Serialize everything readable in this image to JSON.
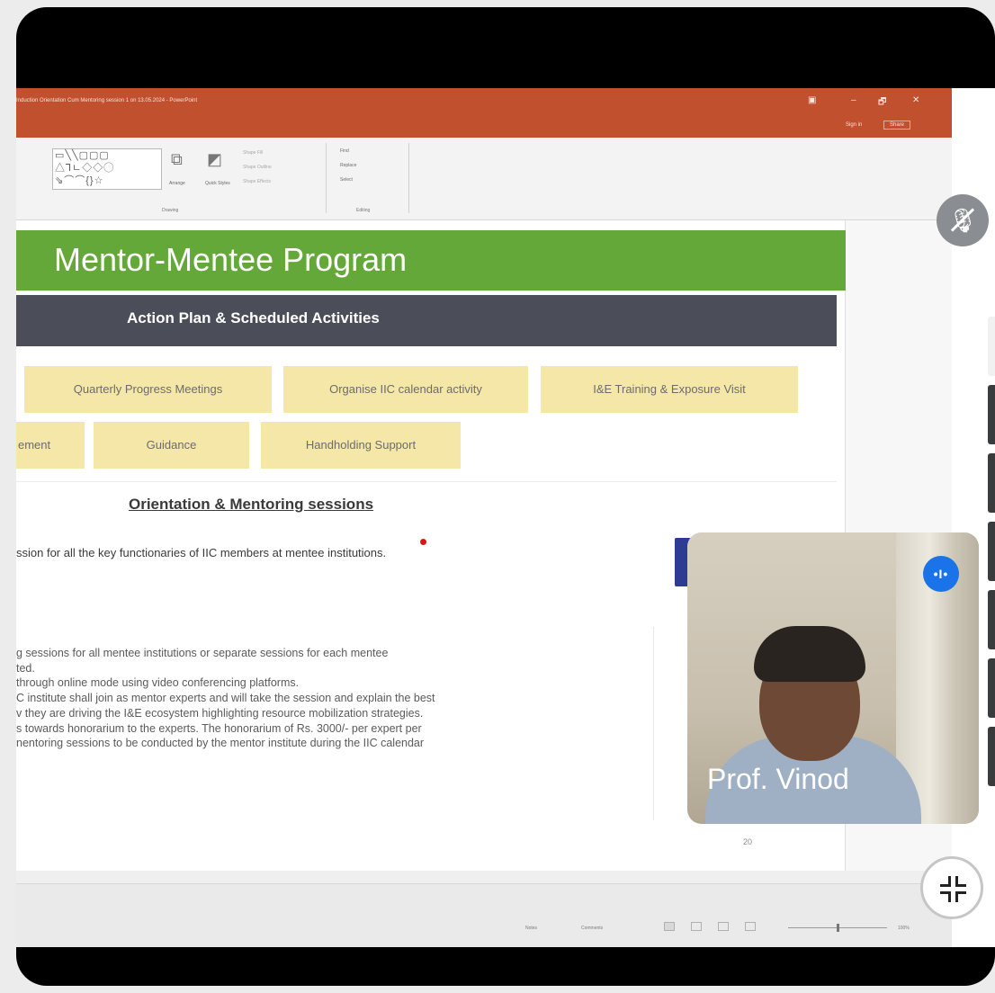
{
  "window": {
    "title": "Induction Orientation Cum Mentoring session 1 on 13.05.2024 - PowerPoint",
    "controls": [
      "▣",
      "–",
      "🗗",
      "✕"
    ],
    "sign_in": "Sign in",
    "share": "Share"
  },
  "ribbon": {
    "arrange_label": "Arrange",
    "quick_styles_label": "Quick Styles",
    "shape_fill": "Shape Fill",
    "shape_outline": "Shape Outline",
    "shape_effects": "Shape Effects",
    "drawing_group": "Drawing",
    "find": "Find",
    "replace": "Replace",
    "select": "Select",
    "editing_group": "Editing"
  },
  "slide": {
    "title": "Mentor-Mentee Program",
    "subtitle": "Action Plan & Scheduled Activities",
    "pills_row1": [
      "Quarterly Progress Meetings",
      "Organise IIC calendar activity",
      "I&E Training & Exposure Visit"
    ],
    "pills_row2": [
      "ement",
      "Guidance",
      "Handholding Support"
    ],
    "section_heading": "Orientation & Mentoring sessions",
    "session_line": "ssion for all the key functionaries of IIC members at mentee institutions.",
    "paragraph": [
      "g sessions for all mentee institutions or separate sessions for each mentee",
      "ted.",
      " through online mode using video conferencing platforms.",
      "C institute shall join as mentor experts and will take the session and explain the best",
      "v they are driving the I&E ecosystem highlighting resource mobilization strategies.",
      "s towards honorarium to the experts. The honorarium of Rs. 3000/- per expert per",
      "nentoring sessions to be conducted by the mentor institute during the IIC calendar"
    ],
    "page_number": "20"
  },
  "status_bar": {
    "notes": "Notes",
    "comments": "Comments",
    "zoom": "100%"
  },
  "meeting": {
    "participant_name": "Prof. Vinod",
    "speaking_indicator": "•I•",
    "mic_icon": "mic-off-icon",
    "collapse_icon": "collapse-icon"
  },
  "colors": {
    "titlebar": "#c1502e",
    "green_bar": "#64a83a",
    "dark_bar": "#4b4e58",
    "pill": "#f5e7a8",
    "speak_blue": "#1a73e8"
  }
}
